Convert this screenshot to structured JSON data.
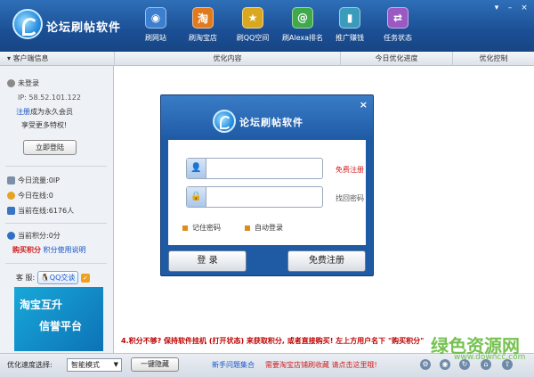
{
  "app": {
    "title": "论坛刷帖软件"
  },
  "nav": [
    {
      "label": "刷网站",
      "icon": "globe-icon",
      "color": "#3d7fcf",
      "glyph": "◉"
    },
    {
      "label": "刷淘宝店",
      "icon": "taobao-icon",
      "color": "#e07a1f",
      "glyph": "淘"
    },
    {
      "label": "刷QQ空间",
      "icon": "star-icon",
      "color": "#d9a820",
      "glyph": "★"
    },
    {
      "label": "刷Alexa排名",
      "icon": "at-icon",
      "color": "#3fa94b",
      "glyph": "@"
    },
    {
      "label": "推广赚钱",
      "icon": "chart-icon",
      "color": "#3a9bbd",
      "glyph": "▮"
    },
    {
      "label": "任务状态",
      "icon": "exchange-icon",
      "color": "#9b59c4",
      "glyph": "⇄"
    }
  ],
  "columns": {
    "client_info": "客户端信息",
    "content": "优化内容",
    "progress": "今日优化进度",
    "control": "优化控制"
  },
  "sidebar": {
    "login_status": "未登录",
    "ip": "IP: 58.52.101.122",
    "register_link": "注册",
    "member_text": "成为永久会员",
    "privilege_text": "享受更多特权!",
    "login_button": "立即登陆",
    "traffic_label": "今日流量:",
    "traffic_value": "0IP",
    "online_label": "今日在线:",
    "online_value": "0",
    "current_online_label": "当前在线:",
    "current_online_value": "6176人",
    "points_label": "当前积分:",
    "points_value": "0分",
    "buy_points": "购买积分",
    "points_help": "积分使用说明",
    "service_label": "客 服:",
    "qq_button": "QQ交谈",
    "banner_line1": "淘宝互升",
    "banner_line2": "信誉平台"
  },
  "notice": "4.积分不够? 保持软件挂机 (打开状态) 来获取积分, 或者直接购买! 左上方用户名下 \"购买积分\"",
  "bottom": {
    "speed_label": "优化速度选择:",
    "speed_value": "智能模式",
    "hide_button": "一键隐藏",
    "faq_link": "新手问题集合",
    "support_link": "需要淘宝店铺刷收藏 请点击这里哦!"
  },
  "dialog": {
    "title": "论坛刷帖软件",
    "username_placeholder": "",
    "password_placeholder": "",
    "register_link": "免费注册",
    "recover_link": "找回密码",
    "remember_label": "记住密码",
    "autologin_label": "自动登录",
    "login_button": "登  录",
    "register_button": "免费注册"
  },
  "watermark": {
    "text": "绿色资源网",
    "url": "www.downcc.com"
  }
}
